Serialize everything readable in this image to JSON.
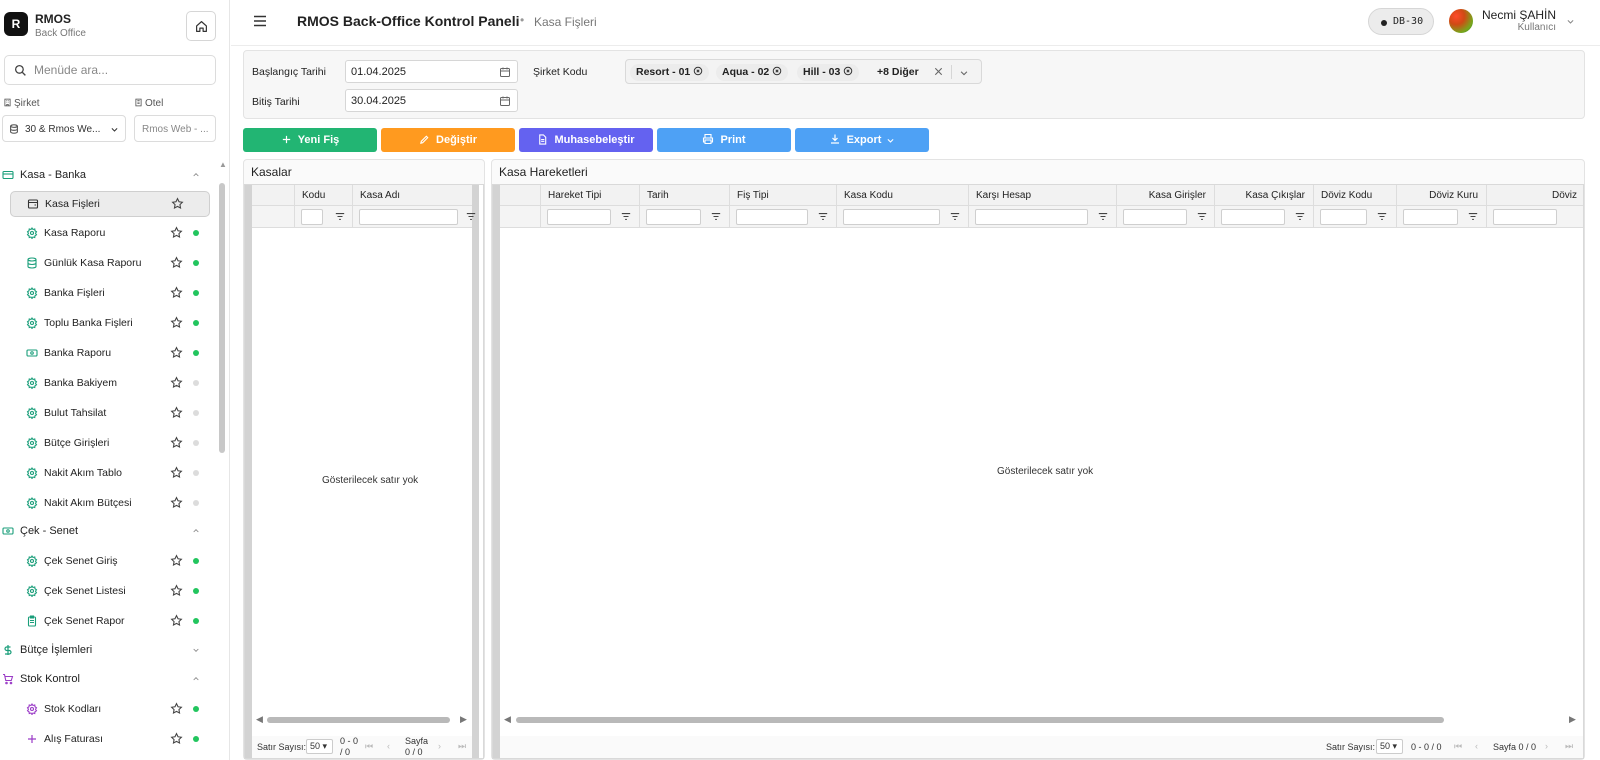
{
  "brand": {
    "logo_letter": "R",
    "title": "RMOS",
    "subtitle": "Back Office"
  },
  "sidebar": {
    "search_placeholder": "Menüde ara...",
    "company_label": "Şirket",
    "company_value": "30 & Rmos We...",
    "hotel_label": "Otel",
    "hotel_placeholder": "Rmos Web - ...",
    "sections": [
      {
        "label": "Kasa - Banka",
        "expanded": true,
        "icon": "credit-card-icon"
      },
      {
        "label": "Çek - Senet",
        "expanded": true,
        "icon": "banknote-icon"
      },
      {
        "label": "Bütçe İşlemleri",
        "expanded": false,
        "icon": "dollar-icon"
      },
      {
        "label": "Stok Kontrol",
        "expanded": true,
        "icon": "cart-icon"
      }
    ],
    "items": [
      {
        "label": "Kasa Fişleri",
        "icon": "cash-register-icon",
        "status": "none",
        "active": true
      },
      {
        "label": "Kasa Raporu",
        "icon": "gear-icon",
        "status": "online"
      },
      {
        "label": "Günlük Kasa Raporu",
        "icon": "database-icon",
        "status": "online"
      },
      {
        "label": "Banka Fişleri",
        "icon": "gear-icon",
        "status": "online"
      },
      {
        "label": "Toplu Banka Fişleri",
        "icon": "gear-icon",
        "status": "online"
      },
      {
        "label": "Banka Raporu",
        "icon": "banknote-icon",
        "status": "online"
      },
      {
        "label": "Banka Bakiyem",
        "icon": "gear-icon",
        "status": "offline"
      },
      {
        "label": "Bulut Tahsilat",
        "icon": "gear-icon",
        "status": "offline"
      },
      {
        "label": "Bütçe Girişleri",
        "icon": "gear-icon",
        "status": "offline"
      },
      {
        "label": "Nakit Akım Tablo",
        "icon": "gear-icon",
        "status": "offline"
      },
      {
        "label": "Nakit Akım Bütçesi",
        "icon": "gear-icon",
        "status": "offline"
      },
      {
        "label": "Çek Senet Giriş",
        "icon": "gear-icon",
        "status": "online"
      },
      {
        "label": "Çek Senet Listesi",
        "icon": "gear-icon",
        "status": "online"
      },
      {
        "label": "Çek Senet Rapor",
        "icon": "clipboard-icon",
        "status": "online"
      },
      {
        "label": "Stok Kodları",
        "icon": "gear-icon",
        "status": "online"
      },
      {
        "label": "Alış Faturası",
        "icon": "plus-icon",
        "status": "online"
      }
    ]
  },
  "header": {
    "title": "RMOS Back-Office Kontrol Paneli",
    "separator": "•",
    "breadcrumb": "Kasa Fişleri",
    "db_badge": "DB-30",
    "user_name": "Necmi ŞAHİN",
    "user_role": "Kullanıcı"
  },
  "filters": {
    "start_label": "Başlangıç Tarihi",
    "start_value": "01.04.2025",
    "end_label": "Bitiş Tarihi",
    "end_value": "30.04.2025",
    "company_label": "Şirket Kodu",
    "chips": [
      "Resort - 01",
      "Aqua - 02",
      "Hill - 03"
    ],
    "more": "+8 Diğer"
  },
  "actions": {
    "new": "Yeni Fiş",
    "edit": "Değiştir",
    "account": "Muhasebeleştir",
    "print": "Print",
    "export": "Export"
  },
  "colors": {
    "new": "#22b573",
    "edit": "#ff9a1f",
    "account": "#6462f0",
    "print": "#4ea1f5",
    "export": "#4ea1f5",
    "dot_online": "#22c55e",
    "dot_offline": "#dcdcdc",
    "icon_teal": "#1a9e7a",
    "icon_purple": "#9b3cc7"
  },
  "kasalar": {
    "title": "Kasalar",
    "columns": [
      "Kodu",
      "Kasa Adı"
    ],
    "empty": "Gösterilecek satır yok",
    "pager": {
      "rows_label": "Satır Sayısı:",
      "rows_value": "50",
      "range_top": "0 - 0",
      "range_bottom": "/ 0",
      "page_top": "Sayfa",
      "page_bottom": "0 / 0"
    }
  },
  "hareketler": {
    "title": "Kasa Hareketleri",
    "columns": [
      "Hareket Tipi",
      "Tarih",
      "Fiş Tipi",
      "Kasa Kodu",
      "Karşı Hesap",
      "Kasa Girişler",
      "Kasa Çıkışlar",
      "Döviz Kodu",
      "Döviz Kuru",
      "Döviz"
    ],
    "empty": "Gösterilecek satır yok",
    "pager": {
      "rows_label": "Satır Sayısı:",
      "rows_value": "50",
      "range": "0 - 0 / 0",
      "page": "Sayfa 0 / 0"
    }
  }
}
